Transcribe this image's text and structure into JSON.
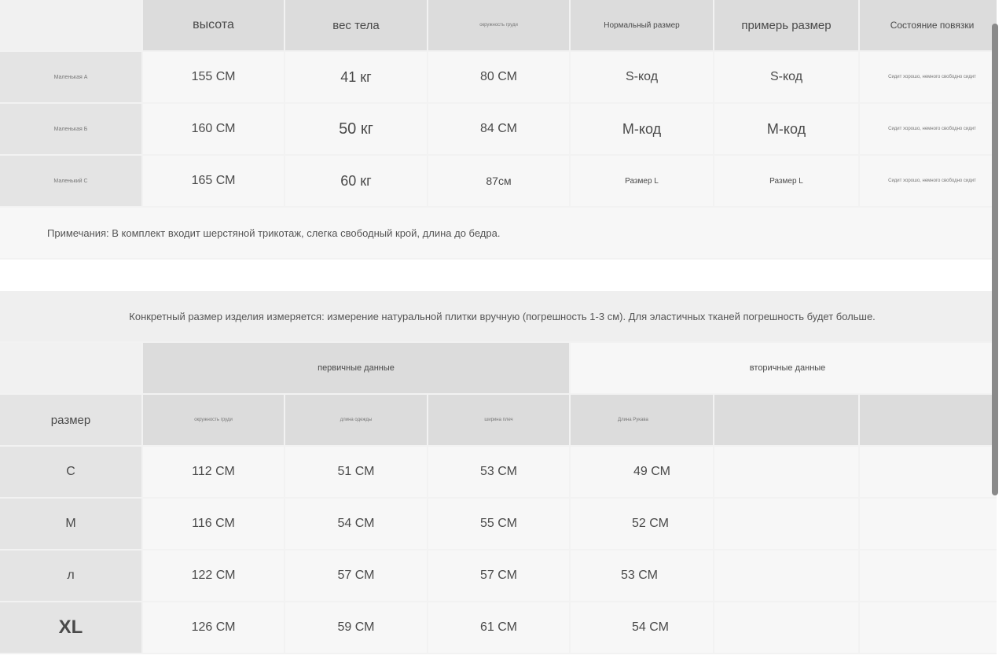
{
  "table1": {
    "headers": [
      "высота",
      "вес тела",
      "окружность груди",
      "Нормальный размер",
      "примерь размер",
      "Состояние повязки"
    ],
    "rows": [
      {
        "label": "Маленькая А",
        "cells": [
          "155 СМ",
          "41 кг",
          "80 СМ",
          "S-код",
          "S-код",
          "Сидит хорошо, немного свободно сидит"
        ]
      },
      {
        "label": "Маленькая Б",
        "cells": [
          "160 СМ",
          "50 кг",
          "84 СМ",
          "М-код",
          "М-код",
          "Сидит хорошо, немного свободно сидит"
        ]
      },
      {
        "label": "Маленький С",
        "cells": [
          "165 СМ",
          "60 кг",
          "87см",
          "Размер L",
          "Размер L",
          "Сидит хорошо, немного свободно сидит"
        ]
      }
    ],
    "note": "Примечания: В комплект входит шерстяной трикотаж, слегка свободный крой, длина до бедра."
  },
  "table2": {
    "intro": "Конкретный размер изделия измеряется: измерение натуральной плитки вручную (погрешность 1-3 см). Для эластичных тканей погрешность будет больше.",
    "group_primary": "первичные данные",
    "group_secondary": "вторичные данные",
    "size_header": "размер",
    "headers": [
      "окружность груди",
      "длина одежды",
      "ширина плеч",
      "Длина Рукава",
      "",
      ""
    ],
    "rows": [
      {
        "size": "С",
        "cells": [
          "112 СМ",
          "51 СМ",
          "53 СМ",
          "49 СМ",
          "",
          ""
        ]
      },
      {
        "size": "М",
        "cells": [
          "116 СМ",
          "54 СМ",
          "55 СМ",
          "52 СМ",
          "",
          ""
        ]
      },
      {
        "size": "л",
        "cells": [
          "122 СМ",
          "57 СМ",
          "57 СМ",
          "53 СМ",
          "",
          ""
        ]
      },
      {
        "size": "XL",
        "cells": [
          "126 СМ",
          "59 СМ",
          "61 СМ",
          "54 СМ",
          "",
          ""
        ]
      }
    ]
  }
}
